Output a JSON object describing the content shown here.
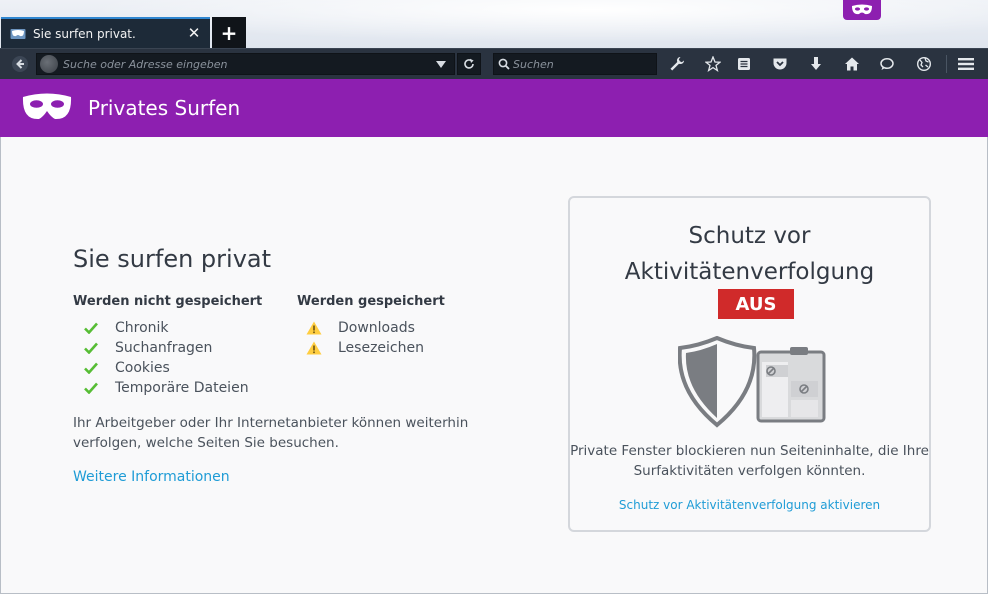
{
  "tab": {
    "title": "Sie surfen privat.",
    "close_glyph": "✕",
    "new_tab_glyph": "+"
  },
  "toolbar": {
    "url_placeholder": "Suche oder Adresse eingeben",
    "search_placeholder": "Suchen",
    "icons": [
      "back-icon",
      "site-identity-icon",
      "url-dropdown-icon",
      "reload-icon",
      "search-icon",
      "wrench-icon",
      "bookmark-star-icon",
      "reading-list-icon",
      "pocket-icon",
      "download-icon",
      "home-icon",
      "chat-icon",
      "globe-icon",
      "menu-icon"
    ]
  },
  "private_header": {
    "title": "Privates Surfen"
  },
  "main": {
    "heading": "Sie surfen privat",
    "not_saved": {
      "heading": "Werden nicht gespeichert",
      "items": [
        "Chronik",
        "Suchanfragen",
        "Cookies",
        "Temporäre Dateien"
      ]
    },
    "saved": {
      "heading": "Werden gespeichert",
      "items": [
        "Downloads",
        "Lesezeichen"
      ]
    },
    "notice": "Ihr Arbeitgeber oder Ihr Internetanbieter können weiterhin verfolgen, welche Seiten Sie besuchen.",
    "more_info": "Weitere Informationen"
  },
  "tracking_protection": {
    "title_line1": "Schutz vor",
    "title_line2": "Aktivitätenverfolgung",
    "state": "AUS",
    "description": "Private Fenster blockieren nun Seiteninhalte, die Ihre Surfaktivitäten verfolgen könnten.",
    "activate_link": "Schutz vor Aktivitätenverfolgung aktivieren"
  },
  "colors": {
    "private_purple": "#8d1fb0",
    "toolbar_dark": "#2a3340",
    "check_green": "#57bd35",
    "warning_yellow": "#ffcd40",
    "state_off_red": "#d02a2a",
    "link_blue": "#1f9cd6"
  }
}
